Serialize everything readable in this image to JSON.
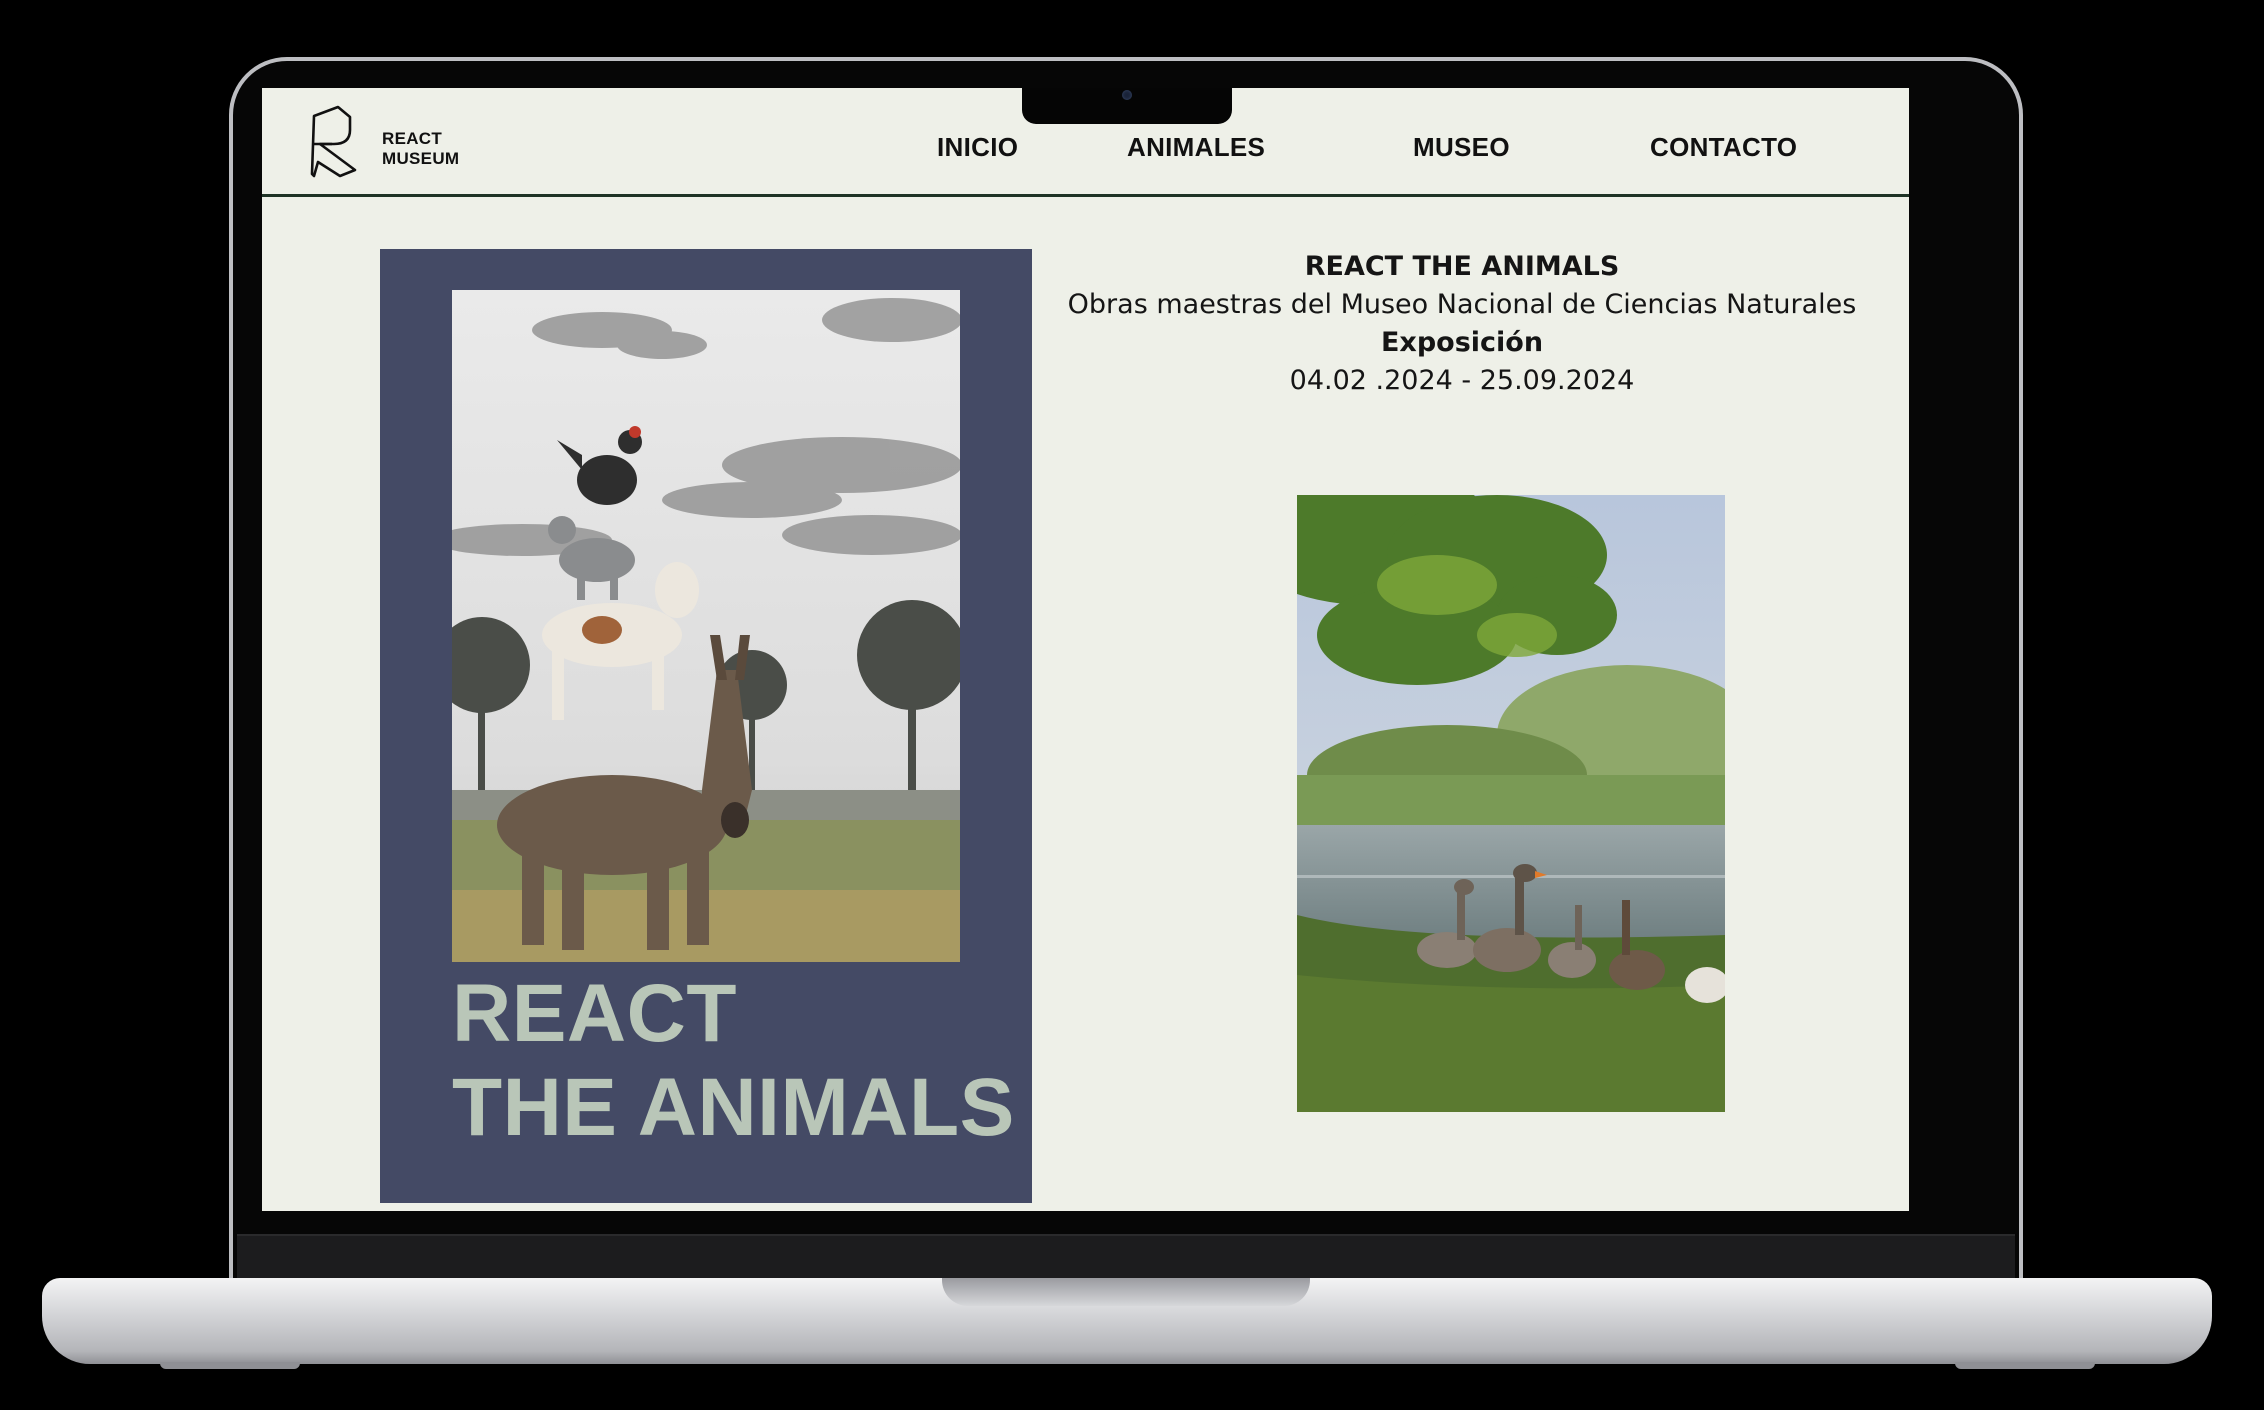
{
  "site": {
    "logo_line1": "REACT",
    "logo_line2": "MUSEUM"
  },
  "nav": {
    "items": [
      "INICIO",
      "ANIMALES",
      "MUSEO",
      "CONTACTO"
    ]
  },
  "poster": {
    "title_line1": "REACT",
    "title_line2": "THE ANIMALS",
    "image": "animal-stack-photo"
  },
  "exhibition": {
    "title": "REACT THE ANIMALS",
    "subtitle": "Obras maestras del Museo Nacional de Ciencias Naturales",
    "label": "Exposición",
    "dates": "04.02 .2024 - 25.09.2024"
  },
  "secondary_image": "geese-by-lake-photo",
  "colors": {
    "page_bg": "#eef0e8",
    "poster_bg": "#444a65",
    "poster_title": "#b9c6b8",
    "header_rule": "#1e3325"
  }
}
